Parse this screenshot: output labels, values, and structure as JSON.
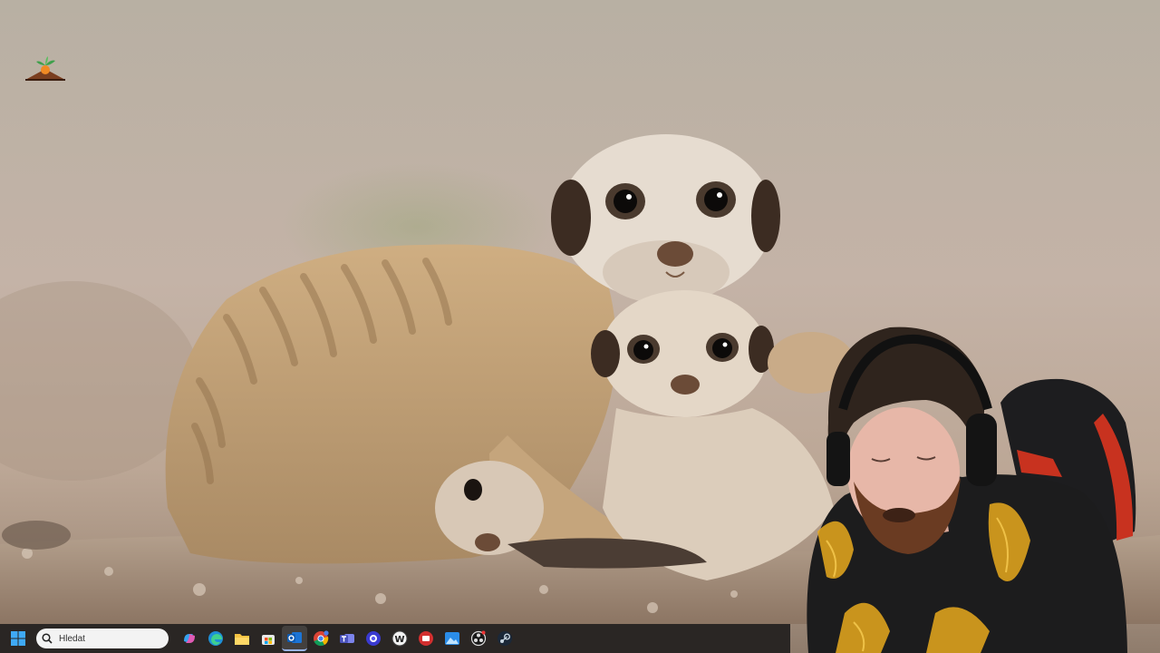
{
  "desktop": {
    "wallpaper_icon": "meerkat-family-photo",
    "shortcut_icon": "carrot-garden-icon"
  },
  "taskbar": {
    "search": {
      "placeholder": "Hledat"
    },
    "icons": [
      "windows-start-icon",
      "search-icon",
      "copilot-icon",
      "edge-icon",
      "file-explorer-icon",
      "microsoft-store-icon",
      "outlook-icon",
      "chrome-icon",
      "teams-icon",
      "assistant-icon",
      "wordpad-icon",
      "recorder-icon",
      "photos-icon",
      "obs-icon",
      "steam-icon"
    ],
    "colors": {
      "background": "#2a2624",
      "active_indicator": "#9ab4e8"
    }
  },
  "webcam_overlay": {
    "subject": "streamer-with-headset"
  }
}
